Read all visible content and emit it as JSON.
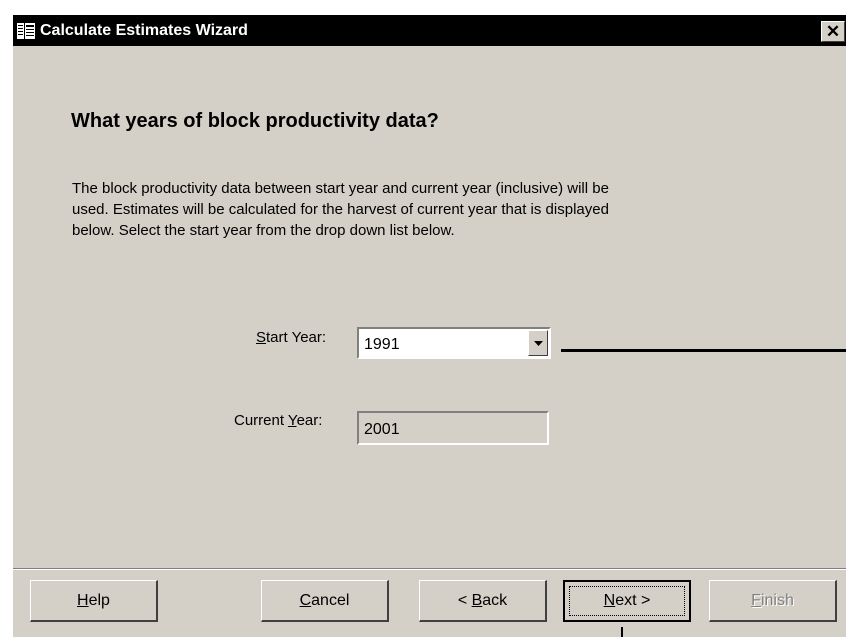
{
  "window": {
    "title": "Calculate Estimates Wizard",
    "close_glyph": "✕",
    "app_icon": "wizard-book-icon"
  },
  "page": {
    "heading": "What years of block productivity data?",
    "description_lines": [
      "The block productivity data between start year and current year (inclusive) will be",
      "used.  Estimates will be calculated for the harvest of current year that is displayed",
      "below.  Select the start year from the drop down list below."
    ]
  },
  "form": {
    "start_year": {
      "label_mnemonic": "S",
      "label_rest": "tart Year:",
      "value": "1991"
    },
    "current_year": {
      "label_prefix": "Current ",
      "label_mnemonic": "Y",
      "label_rest": "ear:",
      "value": "2001"
    }
  },
  "buttons": {
    "help": {
      "mnemonic": "H",
      "rest": "elp"
    },
    "cancel": {
      "mnemonic": "C",
      "rest": "ancel"
    },
    "back": {
      "prefix": "< ",
      "mnemonic": "B",
      "rest": "ack"
    },
    "next": {
      "mnemonic": "N",
      "rest": "ext >"
    },
    "finish": {
      "mnemonic": "F",
      "rest": "inish",
      "enabled": false
    }
  },
  "colors": {
    "titlebar": "#000000",
    "dialog_face": "#d4d0c8",
    "disabled_text": "#808080"
  }
}
